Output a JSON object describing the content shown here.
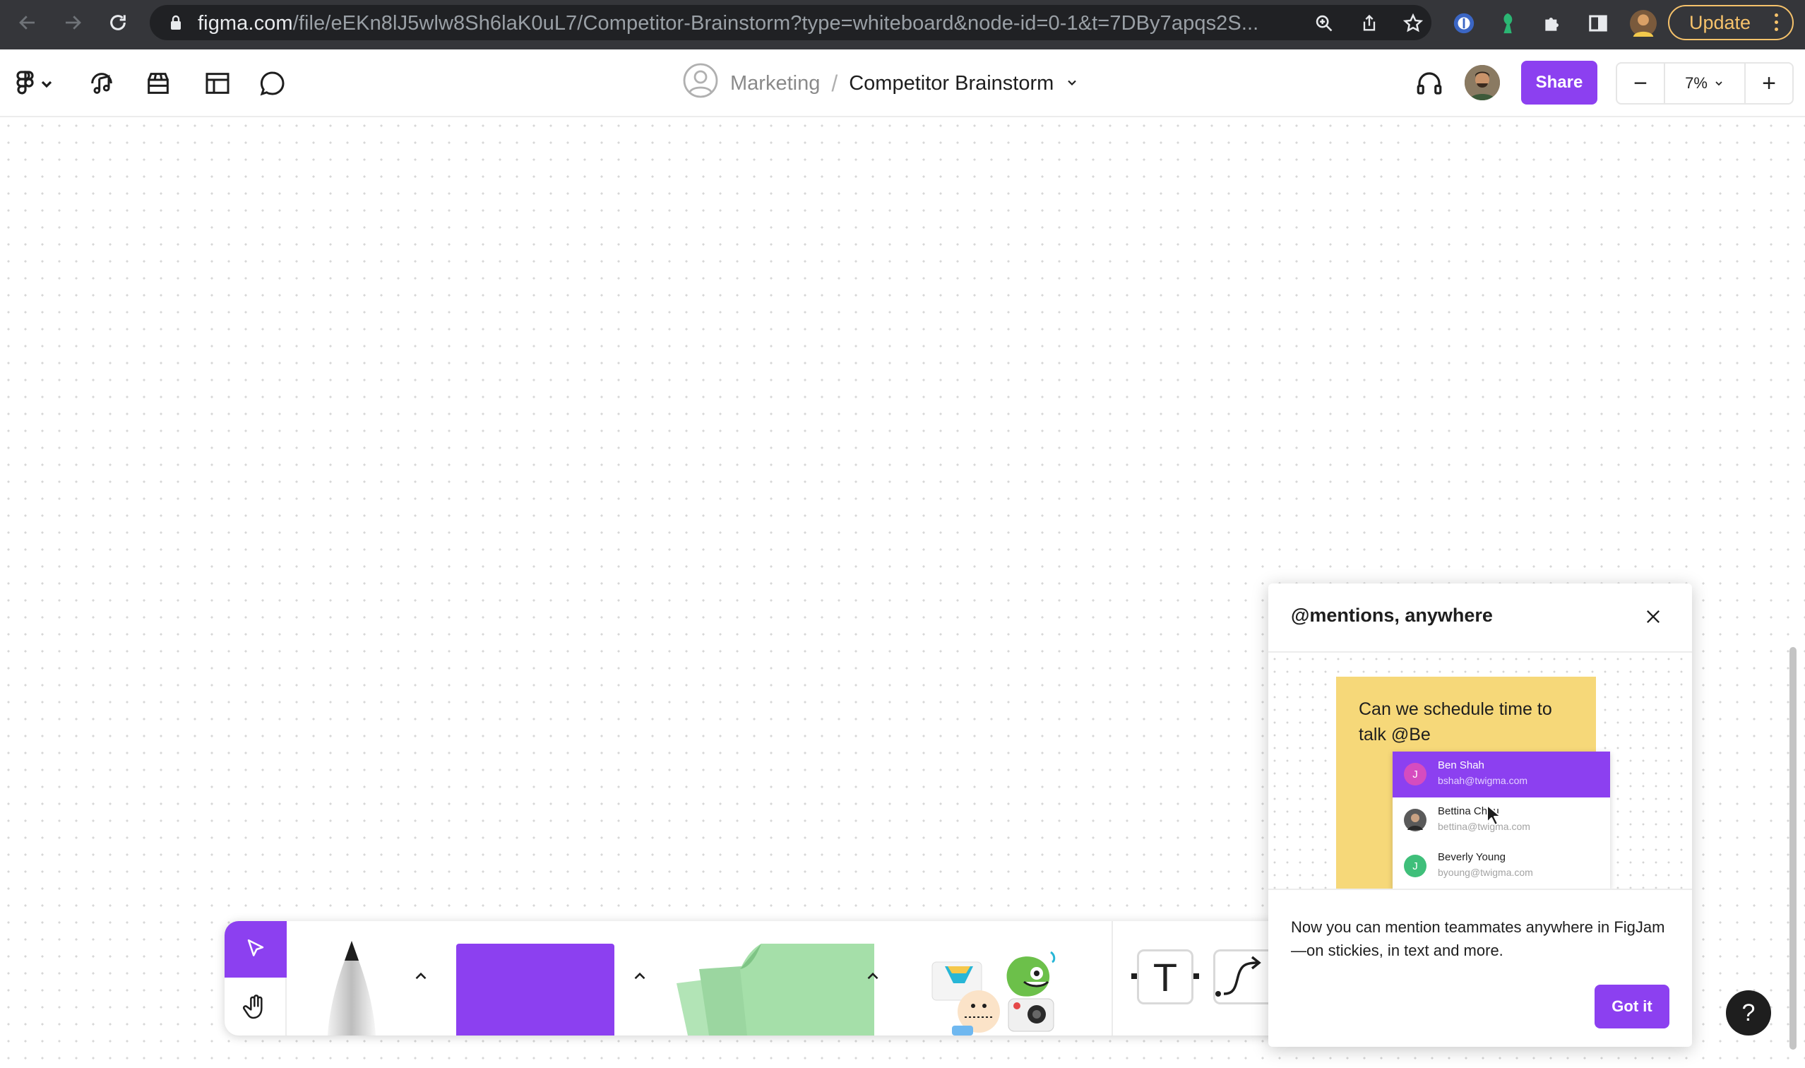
{
  "browser": {
    "url_host": "figma.com",
    "url_path": "/file/eEKn8lJ5wlw8Sh6laK0uL7/Competitor-Brainstorm?type=whiteboard&node-id=0-1&t=7DBy7apqs2S...",
    "update_label": "Update"
  },
  "toolbar": {
    "team": "Marketing",
    "separator": "/",
    "file_name": "Competitor Brainstorm",
    "share_label": "Share",
    "zoom": "7%",
    "zoom_out": "−",
    "zoom_in": "+"
  },
  "popover": {
    "title": "@mentions, anywhere",
    "sticky_text": "Can we schedule time to talk @Be",
    "mentions": [
      {
        "initial": "J",
        "name": "Ben Shah",
        "email": "bshah@twigma.com",
        "avatar_color": "#d64cbf"
      },
      {
        "initial": "",
        "name": "Bettina Chou",
        "email": "bettina@twigma.com",
        "avatar_color": "#4a4a4a"
      },
      {
        "initial": "J",
        "name": "Beverly Young",
        "email": "byoung@twigma.com",
        "avatar_color": "#3fbf7a"
      }
    ],
    "body": "Now you can mention teammates anywhere in FigJam—on stickies, in text and more.",
    "button_label": "Got it"
  },
  "dock": {
    "text_tool_label": "T"
  },
  "help_label": "?",
  "colors": {
    "accent": "#8c40f0",
    "sticky": "#f6d879",
    "sticky_green": "#a5dfa9"
  }
}
